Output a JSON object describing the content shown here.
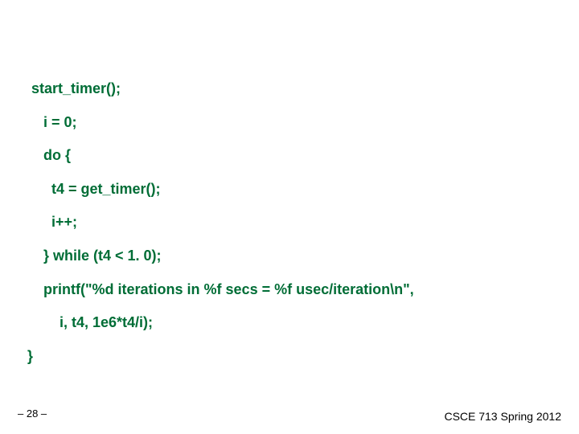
{
  "code": {
    "l1": " start_timer();",
    "l2": "    i = 0;",
    "l3": "    do {",
    "l4": "      t4 = get_timer();",
    "l5": "      i++;",
    "l6": "    } while (t4 < 1. 0);",
    "l7": "    printf(\"%d iterations in %f secs = %f usec/iteration\\n\",",
    "l8": "        i, t4, 1e6*t4/i);",
    "l9": "}"
  },
  "footer": {
    "left": "– 28 –",
    "right": "CSCE 713 Spring 2012"
  }
}
